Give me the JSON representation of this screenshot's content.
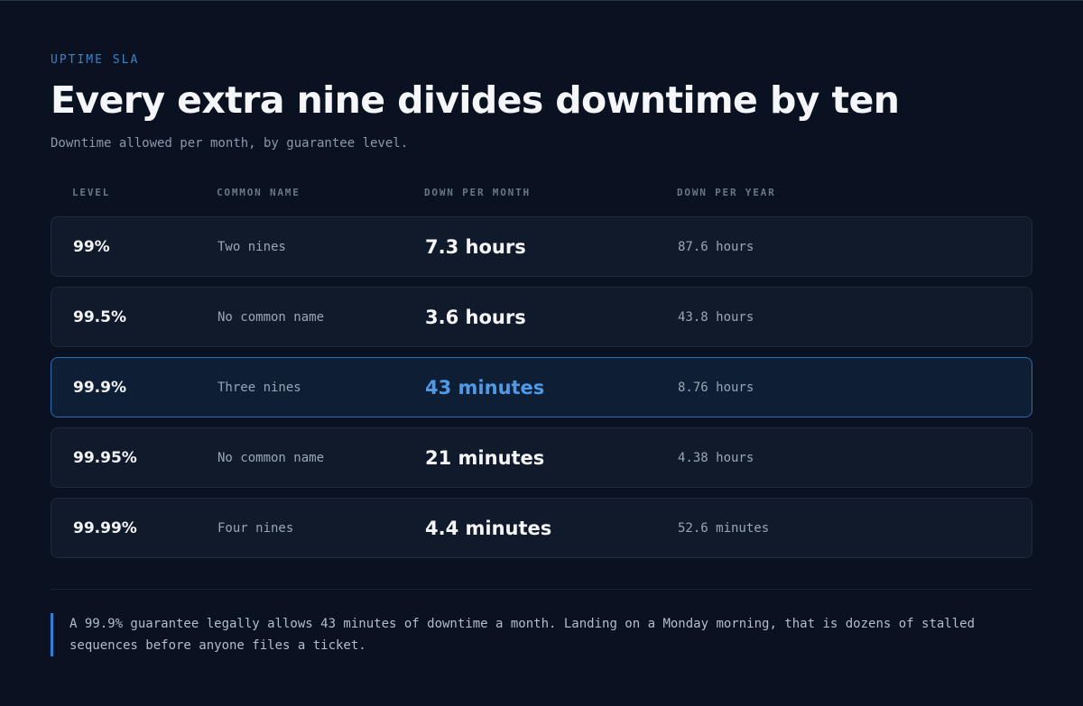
{
  "header": {
    "eyebrow": "UPTIME SLA",
    "title": "Every extra nine divides downtime by ten",
    "subtitle": "Downtime allowed per month, by guarantee level."
  },
  "table": {
    "columns": [
      "LEVEL",
      "COMMON NAME",
      "DOWN PER MONTH",
      "DOWN PER YEAR"
    ],
    "rows": [
      {
        "level": "99%",
        "name": "Two nines",
        "month": "7.3 hours",
        "year": "87.6 hours",
        "highlighted": false
      },
      {
        "level": "99.5%",
        "name": "No common name",
        "month": "3.6 hours",
        "year": "43.8 hours",
        "highlighted": false
      },
      {
        "level": "99.9%",
        "name": "Three nines",
        "month": "43 minutes",
        "year": "8.76 hours",
        "highlighted": true
      },
      {
        "level": "99.95%",
        "name": "No common name",
        "month": "21 minutes",
        "year": "4.38 hours",
        "highlighted": false
      },
      {
        "level": "99.99%",
        "name": "Four nines",
        "month": "4.4 minutes",
        "year": "52.6 minutes",
        "highlighted": false
      }
    ]
  },
  "note": "A 99.9% guarantee legally allows 43 minutes of downtime a month. Landing on a Monday morning, that is dozens of stalled sequences before anyone files a ticket.",
  "colors": {
    "background": "#0a1120",
    "accent": "#2f80d8",
    "highlight_text": "#4f9ae6",
    "row_background": "#111a2b"
  }
}
